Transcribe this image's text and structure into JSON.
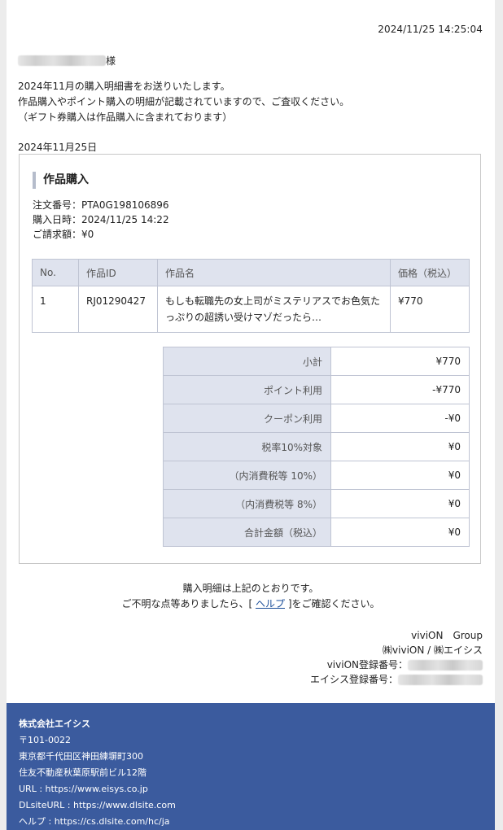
{
  "header": {
    "timestamp": "2024/11/25 14:25:04",
    "recipient_suffix": "様"
  },
  "intro": {
    "line1": "2024年11月の購入明細書をお送りいたします。",
    "line2": "作品購入やポイント購入の明細が記載されていますので、ご査収ください。",
    "line3": "（ギフト券購入は作品購入に含まれております）"
  },
  "order_date": "2024年11月25日",
  "purchase": {
    "section_title": "作品購入",
    "order_no_label": "注文番号：",
    "order_no": "PTA0G198106896",
    "date_label": "購入日時：",
    "date": "2024/11/25 14:22",
    "billed_label": "ご請求額：",
    "billed": "¥0",
    "columns": {
      "no": "No.",
      "id": "作品ID",
      "name": "作品名",
      "price": "価格（税込）"
    },
    "items": [
      {
        "no": "1",
        "id": "RJ01290427",
        "name": "もしも転職先の女上司がミステリアスでお色気たっぷりの超誘い受けマゾだったら…",
        "price": "¥770"
      }
    ],
    "summary": [
      {
        "label": "小計",
        "value": "¥770"
      },
      {
        "label": "ポイント利用",
        "value": "-¥770"
      },
      {
        "label": "クーポン利用",
        "value": "-¥0"
      },
      {
        "label": "税率10%対象",
        "value": "¥0"
      },
      {
        "label": "（内消費税等 10%）",
        "value": "¥0"
      },
      {
        "label": "（内消費税等 8%）",
        "value": "¥0"
      },
      {
        "label": "合計金額（税込）",
        "value": "¥0"
      }
    ]
  },
  "closing": {
    "line1": "購入明細は上記のとおりです。",
    "line2_before": "ご不明な点等ありましたら、[ ",
    "help_link": "ヘルプ",
    "line2_after": " ]をご確認ください。"
  },
  "signature": {
    "group": "viviON　Group",
    "companies": "㈱viviON / ㈱エイシス",
    "vivion_reg_label": "viviON登録番号：",
    "eisys_reg_label": "エイシス登録番号："
  },
  "footer": {
    "company": "株式会社エイシス",
    "postal": "〒101-0022",
    "address1": "東京都千代田区神田練塀町300",
    "address2": "住友不動産秋葉原駅前ビル12階",
    "url": "URL : https://www.eisys.co.jp",
    "dlsite_url": "DLsiteURL : https://www.dlsite.com",
    "help_url": "ヘルプ : https://cs.dlsite.com/hc/ja"
  }
}
